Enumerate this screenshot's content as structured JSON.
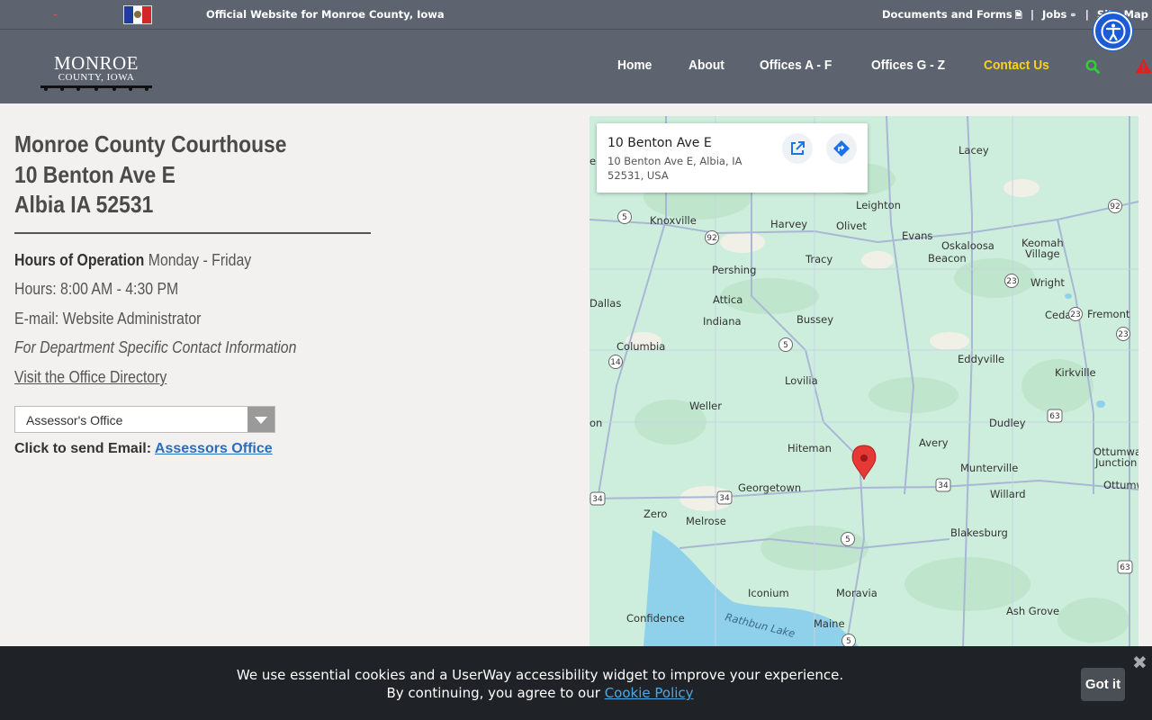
{
  "topbar": {
    "official": "Official Website for Monroe County, Iowa",
    "documents": "Documents and Forms",
    "jobs": "Jobs",
    "sitemap": "Site Map",
    "sep": "|"
  },
  "logo": {
    "line1": "MONROE",
    "line2": "COUNTY, IOWA"
  },
  "nav": {
    "items": [
      "Home",
      "About",
      "Offices A - F",
      "Offices G - Z",
      "Contact Us"
    ],
    "active_color": "#f7d417"
  },
  "address": {
    "line1": "Monroe County Courthouse",
    "line2": "10 Benton Ave E",
    "line3": "Albia IA 52531"
  },
  "info": {
    "hours_label": "Hours of Operation",
    "hours_days": "Monday - Friday",
    "hours": "Hours: 8:00 AM - 4:30 PM",
    "email": "E-mail: Website Administrator",
    "dept": "For Department Specific Contact Information",
    "directory": "Visit the Office Directory"
  },
  "office_select": {
    "selected": "Assessor's Office"
  },
  "send_email": {
    "label": "Click to send Email:",
    "link": "Assessors Office"
  },
  "map": {
    "card_title": "10 Benton Ave E",
    "card_address": "10 Benton Ave E, Albia, IA 52531, USA",
    "places": [
      "Lacey",
      "Knoxville",
      "Harvey",
      "Olivet",
      "Leighton",
      "Evans",
      "Oskaloosa",
      "Keomah Village",
      "Beacon",
      "Tracy",
      "Pershing",
      "Wright",
      "Attica",
      "Indiana",
      "Bussey",
      "Cedar",
      "Fremont",
      "Dallas",
      "Columbia",
      "Eddyville",
      "Kirkville",
      "Lovilia",
      "Weller",
      "Dudley",
      "Hiteman",
      "Avery",
      "Ottumwa Junction",
      "Munterville",
      "Georgetown",
      "Willard",
      "Ottumw",
      "Zero",
      "Melrose",
      "Blakesburg",
      "Iconium",
      "Moravia",
      "Confidence",
      "Rathbun Lake",
      "Maine",
      "Ash Grove",
      "e",
      "on"
    ],
    "highways": [
      "5",
      "92",
      "92",
      "23",
      "23",
      "23",
      "14",
      "5",
      "63",
      "34",
      "34",
      "34",
      "5",
      "63",
      "5"
    ]
  },
  "cookie": {
    "line1": "We use essential cookies and a UserWay accessibility widget to improve your experience.",
    "line2_prefix": "By continuing, you agree to our",
    "policy_link": "Cookie Policy",
    "button": "Got it",
    "close": "✖"
  },
  "colors": {
    "header": "#5d6470",
    "accent": "#f7d417",
    "link": "#2a6dbc"
  }
}
